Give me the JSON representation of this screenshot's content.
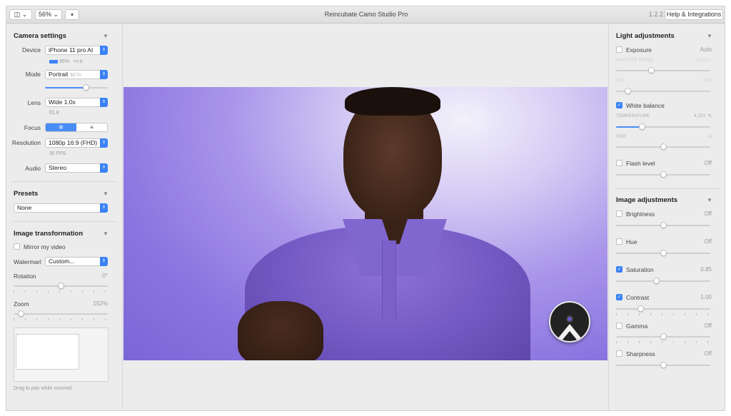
{
  "titlebar": {
    "sidebar_toggle": "◫ ⌄",
    "zoom": "56% ⌄",
    "pause": "⏸",
    "title": "Reincubate Camo Studio Pro",
    "version": "1.2.2",
    "help": "Help & Integrations"
  },
  "camera_settings": {
    "title": "Camera settings",
    "device_label": "Device",
    "device_value": "iPhone 11 pro AI",
    "battery": "95%",
    "connection": "•⊂⊱",
    "mode_label": "Mode",
    "mode_value": "Portrait",
    "mode_badge": "BETA",
    "lens_label": "Lens",
    "lens_value": "Wide 1.0x",
    "aperture": "f/1.8",
    "focus_label": "Focus",
    "focus_auto": "✲",
    "focus_manual": "≡",
    "resolution_label": "Resolution",
    "resolution_value": "1080p 16:9 (FHD)",
    "fps": "30 FPS",
    "audio_label": "Audio",
    "audio_value": "Stereo"
  },
  "presets": {
    "title": "Presets",
    "value": "None"
  },
  "image_transformation": {
    "title": "Image transformation",
    "mirror_label": "Mirror my video",
    "watermark_label": "Watermarl",
    "watermark_value": "Custom...",
    "rotation_label": "Rotation",
    "rotation_value": "0°",
    "zoom_label": "Zoom",
    "zoom_value": "152%",
    "pan_hint": "Drag to pan while zoomed."
  },
  "light_adjustments": {
    "title": "Light adjustments",
    "exposure_label": "Exposure",
    "exposure_value": "Auto",
    "shutter_label": "SHUTTER SPEED",
    "shutter_value": "1/100 s",
    "iso_label": "ISO",
    "iso_value": "1/10",
    "white_balance_label": "White balance",
    "temperature_label": "TEMPERATURE",
    "temperature_value": "4,321 °K",
    "tint_label": "TINT",
    "tint_value": "-1",
    "flash_label": "Flash level",
    "flash_value": "Off"
  },
  "image_adjustments": {
    "title": "Image adjustments",
    "brightness_label": "Brightness",
    "brightness_value": "Off",
    "hue_label": "Hue",
    "hue_value": "Off",
    "saturation_label": "Saturation",
    "saturation_value": "0.85",
    "contrast_label": "Contrast",
    "contrast_value": "1.00",
    "gamma_label": "Gamma",
    "gamma_value": "Off",
    "sharpness_label": "Sharpness",
    "sharpness_value": "Off"
  },
  "checkmark": "✓",
  "chevron": "▼",
  "select_arrow": "⇕",
  "colors": {
    "accent": "#3b82f6",
    "video_bg": "#9d88e6",
    "panel_bg": "#ececec"
  }
}
